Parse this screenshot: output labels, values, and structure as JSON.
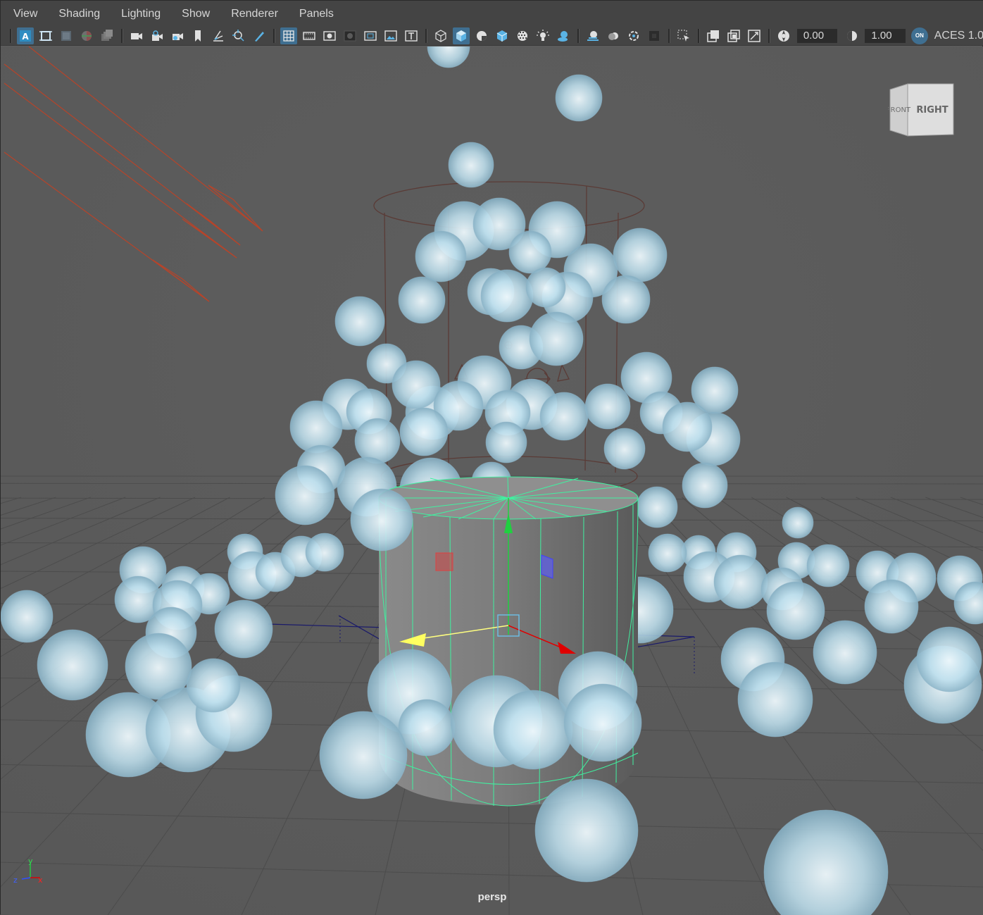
{
  "menu": [
    "View",
    "Shading",
    "Lighting",
    "Show",
    "Renderer",
    "Panels"
  ],
  "toolbar": {
    "exposure_value": "0.00",
    "gamma_value": "1.00",
    "color_mgmt_badge": "ON",
    "color_space": "ACES 1.0",
    "icons_group1": [
      "select-camera-icon",
      "camera-attributes-icon",
      "bookmarks-icon",
      "image-plane-icon",
      "grease-pencil-icon"
    ],
    "icons_group2": [
      "lock-camera-icon",
      "camera-icon",
      "film-gate-icon",
      "2d-pan-zoom-icon",
      "grease-pencil-tool-icon",
      "snapshot-icon",
      "resolution-gate-icon",
      "gate-mask-icon",
      "field-chart-icon",
      "safe-action-icon",
      "safe-title-icon"
    ],
    "icons_group3": [
      "grid-icon",
      "film-gate-toggle-icon",
      "resolution-gate-toggle-icon",
      "gate-mask-toggle-icon",
      "field-chart-toggle-icon",
      "safe-action-toggle-icon",
      "safe-title-toggle-icon"
    ],
    "icons_group4": [
      "wireframe-icon",
      "smooth-shade-icon",
      "use-default-material-icon",
      "wireframe-on-shaded-icon",
      "textured-icon",
      "use-all-lights-icon",
      "shadows-icon"
    ],
    "icons_group5": [
      "screen-space-ao-icon",
      "motion-blur-icon",
      "multisample-aa-icon",
      "depth-of-field-icon"
    ],
    "icons_group6": [
      "isolate-select-icon",
      "xray-icon",
      "xray-active-components-icon",
      "xray-joints-icon"
    ],
    "icons_group7": [
      "exposure-icon",
      "gamma-icon",
      "color-management-icon"
    ]
  },
  "viewport": {
    "camera_label": "persp",
    "viewcube": {
      "face_front": "FRONT",
      "face_right": "RIGHT"
    },
    "axis": {
      "y": "y",
      "z": "z",
      "x": "x"
    }
  },
  "colors": {
    "viewport_bg": "#5b5b5b",
    "grid": "#4a4a4a",
    "particle": "#b8dceb",
    "selection": "#40f0a0",
    "light": "#b6442a"
  }
}
